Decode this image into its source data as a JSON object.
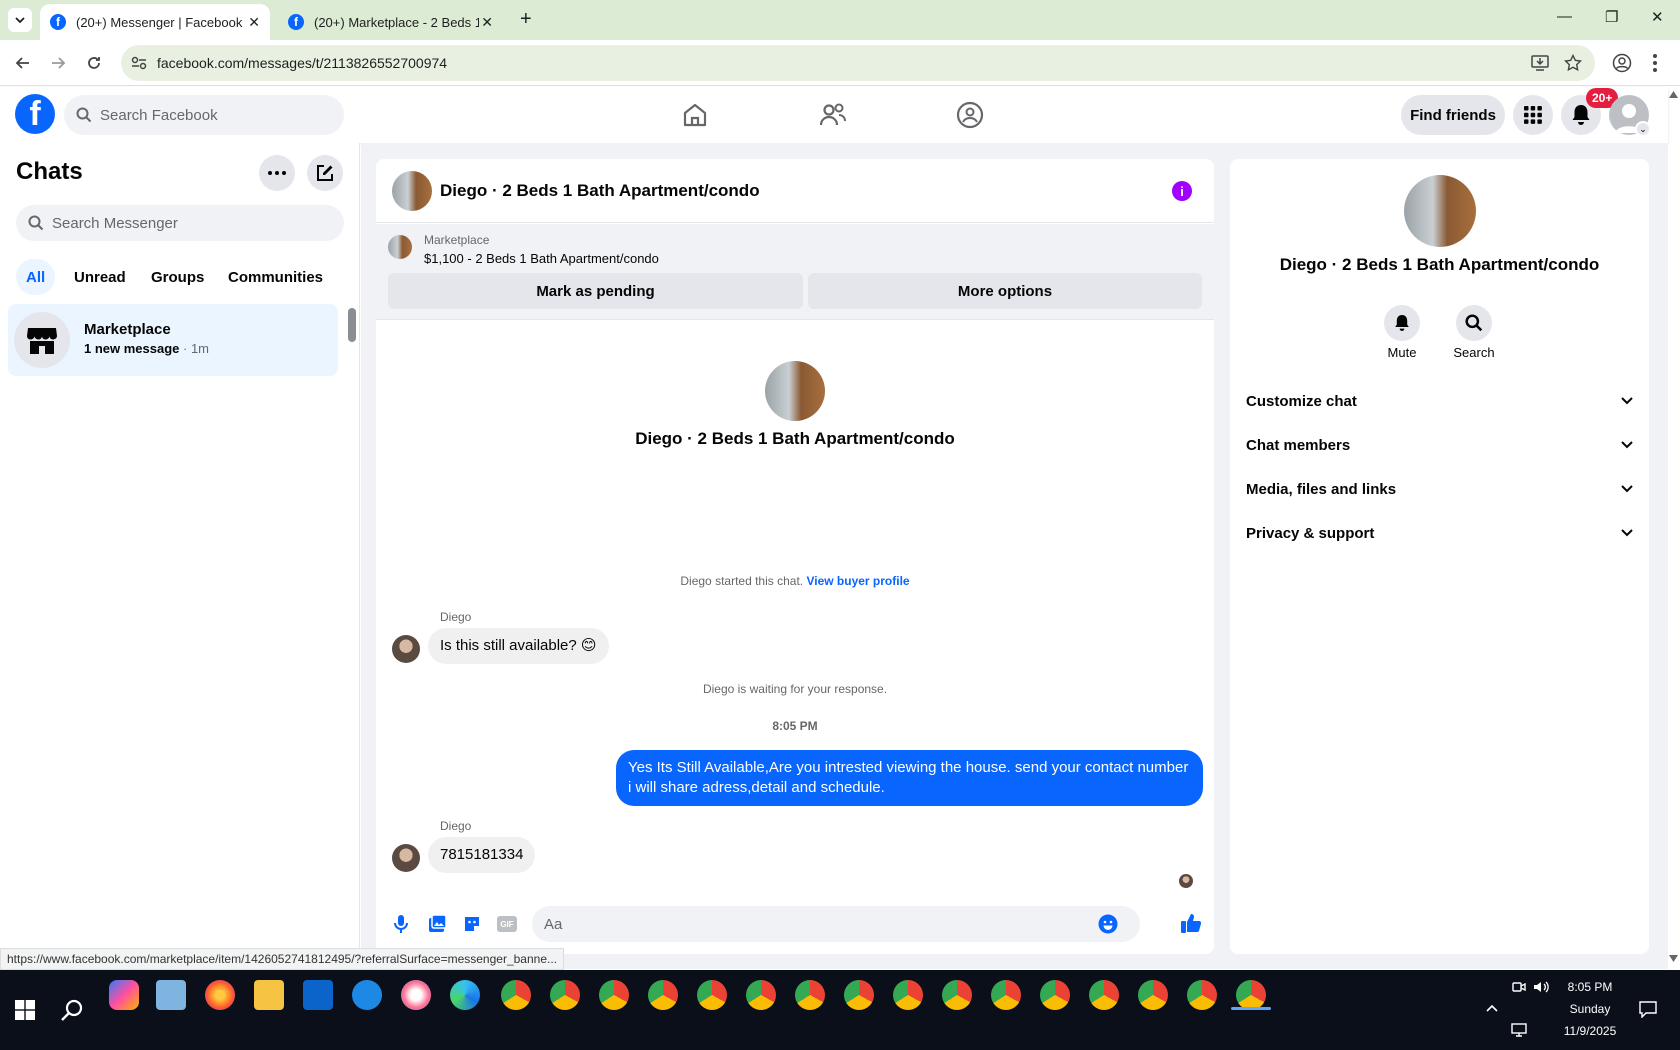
{
  "browser": {
    "tabs": [
      {
        "title": "(20+) Messenger | Facebook"
      },
      {
        "title": "(20+) Marketplace - 2 Beds 1 B"
      }
    ],
    "url": "facebook.com/messages/t/2113826552700974",
    "status_url": "https://www.facebook.com/marketplace/item/1426052741812495/?referralSurface=messenger_banne..."
  },
  "fb_header": {
    "logo": "f",
    "search_placeholder": "Search Facebook",
    "find_friends": "Find friends",
    "notification_badge": "20+"
  },
  "sidebar": {
    "title": "Chats",
    "search_placeholder": "Search Messenger",
    "filters": [
      "All",
      "Unread",
      "Groups",
      "Communities"
    ],
    "chats": [
      {
        "name": "Marketplace",
        "preview": "1 new message",
        "time": "· 1m"
      }
    ]
  },
  "chat": {
    "title": "Diego · 2 Beds 1 Bath Apartment/condo",
    "banner": {
      "label": "Marketplace",
      "listing": "$1,100 - 2 Beds 1 Bath Apartment/condo",
      "pending_button": "Mark as pending",
      "more_button": "More options"
    },
    "intro_name": "Diego · 2 Beds 1 Bath Apartment/condo",
    "started_text": "Diego started this chat.",
    "buyer_link": "View buyer profile",
    "messages": [
      {
        "sender": "Diego",
        "text": "Is this still available? 😊"
      },
      {
        "text": "Yes Its Still Available,Are you intrested viewing the house. send your contact number i will share adress,detail and schedule."
      },
      {
        "sender": "Diego",
        "text": "7815181334"
      }
    ],
    "waiting_text": "Diego is waiting for your response.",
    "timestamp": "8:05 PM",
    "composer_placeholder": "Aa"
  },
  "info": {
    "name": "Diego · 2 Beds 1 Bath Apartment/condo",
    "mute": "Mute",
    "search": "Search",
    "sections": [
      "Customize chat",
      "Chat members",
      "Media, files and links",
      "Privacy & support"
    ]
  },
  "taskbar": {
    "time": "8:05 PM",
    "day": "Sunday",
    "date": "11/9/2025"
  },
  "colors": {
    "fb_blue": "#0866ff",
    "info_purple": "#a100ff",
    "badge_red": "#e41e3f"
  }
}
